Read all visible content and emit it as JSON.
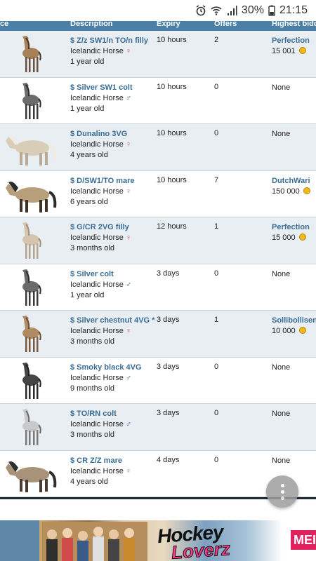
{
  "status_bar": {
    "battery": "30%",
    "time": "21:15",
    "icons": [
      "alarm-icon",
      "wifi-icon",
      "signal-icon",
      "battery-icon"
    ]
  },
  "table": {
    "headers": {
      "price": "ce",
      "description": "Description",
      "expiry": "Expiry",
      "offers": "Offers",
      "highest_bid": "Highest bidd"
    },
    "rows": [
      {
        "title": "$ Z/z SW1/n TO/n filly",
        "breed": "Icelandic Horse",
        "gender": "♀",
        "age": "1 year old",
        "expiry": "10 hours",
        "offers": "2",
        "bidder": "Perfection",
        "amount": "15 001",
        "coat": "bay-pinto-foal"
      },
      {
        "title": "$ Silver SW1 colt",
        "breed": "Icelandic Horse",
        "gender": "♂",
        "age": "1 year old",
        "expiry": "10 hours",
        "offers": "0",
        "bidder": "",
        "none": "None",
        "coat": "dark-grey-foal"
      },
      {
        "title": "$ Dunalino 3VG",
        "breed": "Icelandic Horse",
        "gender": "♀",
        "age": "4 years old",
        "expiry": "10 hours",
        "offers": "0",
        "bidder": "",
        "none": "None",
        "coat": "cream-adult"
      },
      {
        "title": "$ D/SW1/TO mare",
        "breed": "Icelandic Horse",
        "gender": "♀",
        "age": "6 years old",
        "expiry": "10 hours",
        "offers": "7",
        "bidder": "DutchWari",
        "amount": "150 000",
        "coat": "dun-adult"
      },
      {
        "title": "$ G/CR 2VG filly",
        "breed": "Icelandic Horse",
        "gender": "♀",
        "age": "3 months old",
        "expiry": "12 hours",
        "offers": "1",
        "bidder": "Perfection",
        "amount": "15 000",
        "coat": "light-foal"
      },
      {
        "title": "$ Silver colt",
        "breed": "Icelandic Horse",
        "gender": "♂",
        "age": "1 year old",
        "expiry": "3 days",
        "offers": "0",
        "bidder": "",
        "none": "None",
        "coat": "dark-grey-foal"
      },
      {
        "title": "$ Silver chestnut 4VG *",
        "breed": "Icelandic Horse",
        "gender": "♀",
        "age": "3 months old",
        "expiry": "3 days",
        "offers": "1",
        "bidder": "Sollibollisen",
        "amount": "10 000",
        "coat": "chestnut-foal"
      },
      {
        "title": "$ Smoky black 4VG",
        "breed": "Icelandic Horse",
        "gender": "♂",
        "age": "9 months old",
        "expiry": "3 days",
        "offers": "0",
        "bidder": "",
        "none": "None",
        "coat": "black-foal"
      },
      {
        "title": "$ TO/RN colt",
        "breed": "Icelandic Horse",
        "gender": "♂",
        "age": "3 months old",
        "expiry": "3 days",
        "offers": "0",
        "bidder": "",
        "none": "None",
        "coat": "roan-foal"
      },
      {
        "title": "$ CR Z/Z mare",
        "breed": "Icelandic Horse",
        "gender": "♀",
        "age": "4 years old",
        "expiry": "4 days",
        "offers": "0",
        "bidder": "",
        "none": "None",
        "coat": "grey-adult"
      }
    ]
  },
  "fab": {
    "icon": "more-vert-icon"
  },
  "ad": {
    "headline": "Hockey",
    "subline": "Loverz",
    "corner": "MEI"
  },
  "colors": {
    "header_bg": "#4a7fa8",
    "link": "#3a6d96",
    "female": "#d15c8a",
    "male": "#2f6aa3",
    "coin": "#f2b81c"
  }
}
